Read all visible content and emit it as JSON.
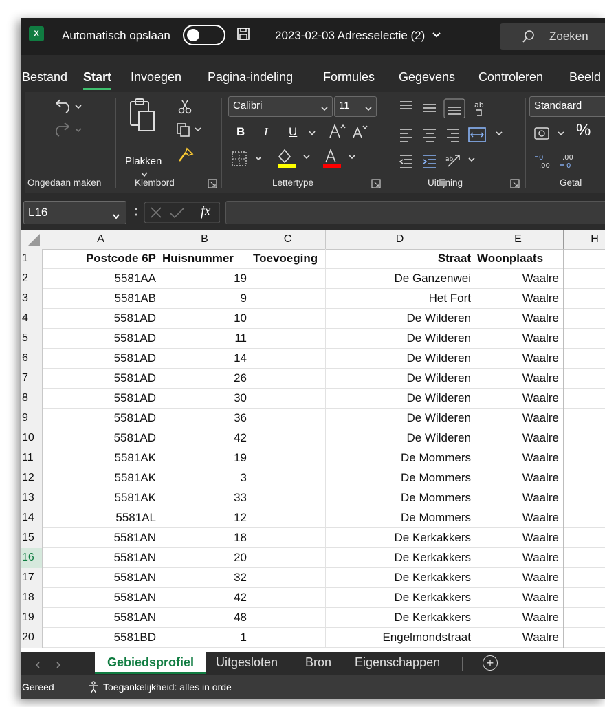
{
  "title_bar": {
    "app_icon_label": "X",
    "autosave_label": "Automatisch opslaan",
    "autosave_state": "off",
    "file_name": "2023-02-03 Adresselectie (2)",
    "search_label": "Zoeken"
  },
  "tabs": [
    "Bestand",
    "Start",
    "Invoegen",
    "Pagina-indeling",
    "Formules",
    "Gegevens",
    "Controleren",
    "Beeld"
  ],
  "active_tab": "Start",
  "ribbon": {
    "groups": [
      "Ongedaan maken",
      "Klembord",
      "Lettertype",
      "Uitlijning",
      "Getal"
    ],
    "paste_label": "Plakken",
    "font_name": "Calibri",
    "font_size": "11",
    "number_format": "Standaard",
    "bold_glyph": "B",
    "italic_glyph": "I",
    "underline_glyph": "U",
    "percent_glyph": "%",
    "accent_color": "#107c41",
    "highlight_color": "#ffff00",
    "font_color": "#ff0000"
  },
  "formula_bar": {
    "cell_ref": "L16",
    "fx_label": "fx",
    "formula": ""
  },
  "columns": [
    "A",
    "B",
    "C",
    "D",
    "E",
    "H"
  ],
  "header_row": [
    "Postcode 6P",
    "Huisnummer",
    "Toevoeging",
    "Straat",
    "Woonplaats"
  ],
  "rows": [
    {
      "n": "1"
    },
    {
      "n": "2",
      "cells": [
        "5581AA",
        "19",
        "",
        "De Ganzenwei",
        "Waalre"
      ]
    },
    {
      "n": "3",
      "cells": [
        "5581AB",
        "9",
        "",
        "Het Fort",
        "Waalre"
      ]
    },
    {
      "n": "4",
      "cells": [
        "5581AD",
        "10",
        "",
        "De Wilderen",
        "Waalre"
      ]
    },
    {
      "n": "5",
      "cells": [
        "5581AD",
        "11",
        "",
        "De Wilderen",
        "Waalre"
      ]
    },
    {
      "n": "6",
      "cells": [
        "5581AD",
        "14",
        "",
        "De Wilderen",
        "Waalre"
      ]
    },
    {
      "n": "7",
      "cells": [
        "5581AD",
        "26",
        "",
        "De Wilderen",
        "Waalre"
      ]
    },
    {
      "n": "8",
      "cells": [
        "5581AD",
        "30",
        "",
        "De Wilderen",
        "Waalre"
      ]
    },
    {
      "n": "9",
      "cells": [
        "5581AD",
        "36",
        "",
        "De Wilderen",
        "Waalre"
      ]
    },
    {
      "n": "10",
      "cells": [
        "5581AD",
        "42",
        "",
        "De Wilderen",
        "Waalre"
      ]
    },
    {
      "n": "11",
      "cells": [
        "5581AK",
        "19",
        "",
        "De Mommers",
        "Waalre"
      ]
    },
    {
      "n": "12",
      "cells": [
        "5581AK",
        "3",
        "",
        "De Mommers",
        "Waalre"
      ]
    },
    {
      "n": "13",
      "cells": [
        "5581AK",
        "33",
        "",
        "De Mommers",
        "Waalre"
      ]
    },
    {
      "n": "14",
      "cells": [
        "5581AL",
        "12",
        "",
        "De Mommers",
        "Waalre"
      ]
    },
    {
      "n": "15",
      "cells": [
        "5581AN",
        "18",
        "",
        "De Kerkakkers",
        "Waalre"
      ]
    },
    {
      "n": "16",
      "cells": [
        "5581AN",
        "20",
        "",
        "De Kerkakkers",
        "Waalre"
      ]
    },
    {
      "n": "17",
      "cells": [
        "5581AN",
        "32",
        "",
        "De Kerkakkers",
        "Waalre"
      ]
    },
    {
      "n": "18",
      "cells": [
        "5581AN",
        "42",
        "",
        "De Kerkakkers",
        "Waalre"
      ]
    },
    {
      "n": "19",
      "cells": [
        "5581AN",
        "48",
        "",
        "De Kerkakkers",
        "Waalre"
      ]
    },
    {
      "n": "20",
      "cells": [
        "5581BD",
        "1",
        "",
        "Engelmondstraat",
        "Waalre"
      ]
    }
  ],
  "selected_row": "16",
  "sheet_tabs": [
    "Gebiedsprofiel",
    "Uitgesloten",
    "Bron",
    "Eigenschappen"
  ],
  "active_sheet": "Gebiedsprofiel",
  "add_sheet_glyph": "+",
  "status_bar": {
    "ready": "Gereed",
    "accessibility": "Toegankelijkheid: alles in orde"
  }
}
